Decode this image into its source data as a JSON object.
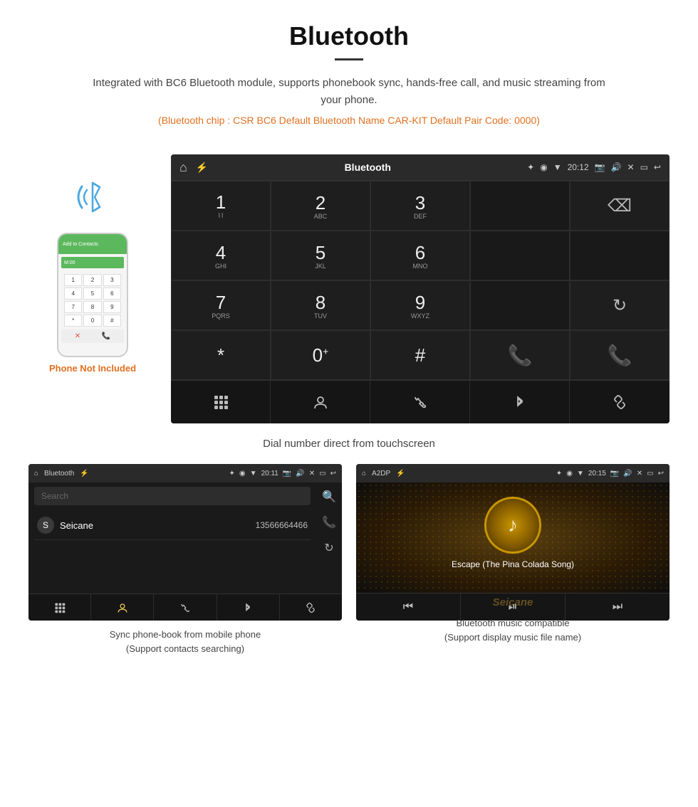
{
  "header": {
    "title": "Bluetooth",
    "description": "Integrated with BC6 Bluetooth module, supports phonebook sync, hands-free call, and music streaming from your phone.",
    "specs": "(Bluetooth chip : CSR BC6    Default Bluetooth Name CAR-KIT    Default Pair Code: 0000)"
  },
  "phone": {
    "not_included_label": "Phone Not Included",
    "top_label": "Add to Contacts"
  },
  "main_screen": {
    "status_bar": {
      "label": "Bluetooth",
      "time": "20:12"
    },
    "dial_keys": [
      {
        "num": "1",
        "sub": ""
      },
      {
        "num": "2",
        "sub": "ABC"
      },
      {
        "num": "3",
        "sub": "DEF"
      },
      {
        "num": "",
        "sub": ""
      },
      {
        "num": "⌫",
        "sub": ""
      }
    ],
    "row2": [
      {
        "num": "4",
        "sub": "GHI"
      },
      {
        "num": "5",
        "sub": "JKL"
      },
      {
        "num": "6",
        "sub": "MNO"
      },
      {
        "num": "",
        "sub": ""
      },
      {
        "num": "",
        "sub": ""
      }
    ],
    "row3": [
      {
        "num": "7",
        "sub": "PQRS"
      },
      {
        "num": "8",
        "sub": "TUV"
      },
      {
        "num": "9",
        "sub": "WXYZ"
      },
      {
        "num": "",
        "sub": ""
      },
      {
        "num": "↻",
        "sub": ""
      }
    ],
    "row4": [
      {
        "num": "*",
        "sub": ""
      },
      {
        "num": "0",
        "sub": "+"
      },
      {
        "num": "#",
        "sub": ""
      },
      {
        "num": "📞",
        "sub": "green"
      },
      {
        "num": "",
        "sub": ""
      },
      {
        "num": "📞",
        "sub": "red"
      }
    ],
    "caption": "Dial number direct from touchscreen"
  },
  "phonebook_screen": {
    "status_bar": {
      "label": "Bluetooth",
      "time": "20:11"
    },
    "search_placeholder": "Search",
    "contacts": [
      {
        "letter": "S",
        "name": "Seicane",
        "number": "13566664466"
      }
    ],
    "caption_line1": "Sync phone-book from mobile phone",
    "caption_line2": "(Support contacts searching)"
  },
  "music_screen": {
    "status_bar": {
      "label": "A2DP",
      "time": "20:15"
    },
    "song_title": "Escape (The Pina Colada Song)",
    "caption_line1": "Bluetooth music compatible",
    "caption_line2": "(Support display music file name)"
  },
  "watermark": "Seicane"
}
